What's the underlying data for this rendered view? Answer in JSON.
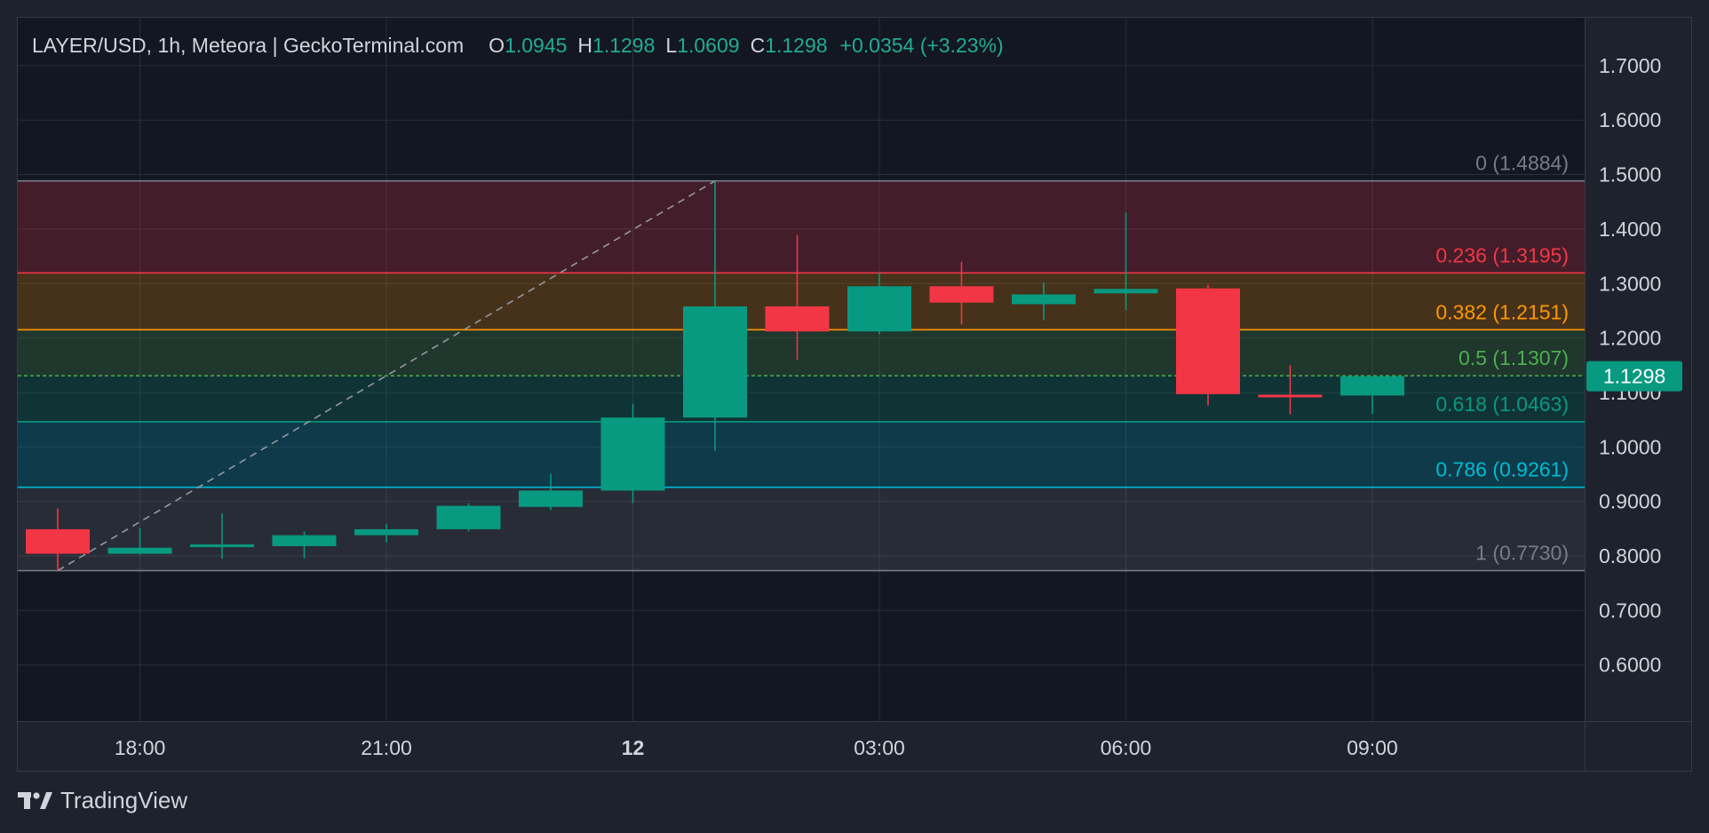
{
  "header": {
    "symbol_line": "LAYER/USD, 1h, Meteora | GeckoTerminal.com",
    "open_label": "O",
    "open_value": "1.0945",
    "high_label": "H",
    "high_value": "1.1298",
    "low_label": "L",
    "low_value": "1.0609",
    "close_label": "C",
    "close_value": "1.1298",
    "change": "+0.0354 (+3.23%)"
  },
  "footer": {
    "brand": "TradingView",
    "brand_icon": "tradingview-logo-icon"
  },
  "colors": {
    "background": "#1e222d",
    "pane": "#131722",
    "grid": "#2a2e39",
    "up": "#089981",
    "down": "#f23645",
    "text": "#d1d4dc",
    "muted": "#878b94"
  },
  "chart_data": {
    "type": "candlestick",
    "interval": "1h",
    "ylim": [
      0.5,
      1.7
    ],
    "y_ticks": [
      "1.7000",
      "1.6000",
      "1.5000",
      "1.4000",
      "1.3000",
      "1.2000",
      "1.1000",
      "1.0000",
      "0.9000",
      "0.8000",
      "0.7000",
      "0.6000"
    ],
    "x_ticks": [
      {
        "label": "18:00",
        "bar": 1,
        "bold": false
      },
      {
        "label": "21:00",
        "bar": 4,
        "bold": false
      },
      {
        "label": "12",
        "bar": 7,
        "bold": true
      },
      {
        "label": "03:00",
        "bar": 10,
        "bold": false
      },
      {
        "label": "06:00",
        "bar": 13,
        "bold": false
      },
      {
        "label": "09:00",
        "bar": 16,
        "bold": false
      }
    ],
    "candles": [
      {
        "open": 0.849,
        "high": 0.887,
        "low": 0.773,
        "close": 0.804
      },
      {
        "open": 0.804,
        "high": 0.851,
        "low": 0.802,
        "close": 0.815
      },
      {
        "open": 0.818,
        "high": 0.878,
        "low": 0.795,
        "close": 0.821
      },
      {
        "open": 0.818,
        "high": 0.845,
        "low": 0.795,
        "close": 0.838
      },
      {
        "open": 0.838,
        "high": 0.858,
        "low": 0.825,
        "close": 0.849
      },
      {
        "open": 0.849,
        "high": 0.897,
        "low": 0.845,
        "close": 0.892
      },
      {
        "open": 0.89,
        "high": 0.951,
        "low": 0.884,
        "close": 0.92
      },
      {
        "open": 0.92,
        "high": 1.079,
        "low": 0.897,
        "close": 1.054
      },
      {
        "open": 1.054,
        "high": 1.488,
        "low": 0.993,
        "close": 1.258
      },
      {
        "open": 1.258,
        "high": 1.389,
        "low": 1.16,
        "close": 1.212
      },
      {
        "open": 1.212,
        "high": 1.32,
        "low": 1.207,
        "close": 1.295
      },
      {
        "open": 1.295,
        "high": 1.34,
        "low": 1.225,
        "close": 1.265
      },
      {
        "open": 1.262,
        "high": 1.302,
        "low": 1.233,
        "close": 1.28
      },
      {
        "open": 1.282,
        "high": 1.43,
        "low": 1.251,
        "close": 1.29
      },
      {
        "open": 1.291,
        "high": 1.298,
        "low": 1.076,
        "close": 1.097
      },
      {
        "open": 1.096,
        "high": 1.15,
        "low": 1.06,
        "close": 1.093
      },
      {
        "open": 1.0945,
        "high": 1.1298,
        "low": 1.0609,
        "close": 1.1298
      }
    ],
    "last_price": "1.1298",
    "fibonacci": {
      "from": {
        "bar": 0,
        "price": 0.773
      },
      "to": {
        "bar": 8,
        "price": 1.4884
      },
      "levels": [
        {
          "ratio": 0,
          "price": 1.4884,
          "label": "0 (1.4884)",
          "color": "#787b86",
          "band": "#f23645"
        },
        {
          "ratio": 0.236,
          "price": 1.3195,
          "label": "0.236 (1.3195)",
          "color": "#f23645",
          "band": "#ff9800"
        },
        {
          "ratio": 0.382,
          "price": 1.2151,
          "label": "0.382 (1.2151)",
          "color": "#ff9800",
          "band": "#4caf50"
        },
        {
          "ratio": 0.5,
          "price": 1.1307,
          "label": "0.5 (1.1307)",
          "color": "#4caf50",
          "band": "#089981"
        },
        {
          "ratio": 0.618,
          "price": 1.0463,
          "label": "0.618 (1.0463)",
          "color": "#089981",
          "band": "#00bcd4"
        },
        {
          "ratio": 0.786,
          "price": 0.9261,
          "label": "0.786 (0.9261)",
          "color": "#00bcd4",
          "band": "#787b86"
        },
        {
          "ratio": 1,
          "price": 0.773,
          "label": "1 (0.7730)",
          "color": "#787b86",
          "band": null
        }
      ]
    }
  }
}
